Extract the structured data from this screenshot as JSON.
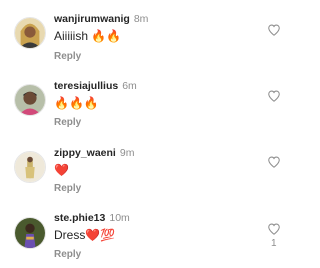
{
  "comments": [
    {
      "username": "wanjirumwanig",
      "time": "8m",
      "text": "Aiiiiish 🔥🔥",
      "reply": "Reply",
      "avatar_icon": "user-avatar-icon",
      "like_icon": "heart-outline-icon",
      "avatar_bg": "#caa24f"
    },
    {
      "username": "teresiajullius",
      "time": "6m",
      "text": "🔥🔥🔥",
      "reply": "Reply",
      "avatar_icon": "user-avatar-icon",
      "like_icon": "heart-outline-icon",
      "avatar_bg": "#9aa38c"
    },
    {
      "username": "zippy_waeni",
      "time": "9m",
      "text": "❤️",
      "reply": "Reply",
      "avatar_icon": "user-avatar-icon",
      "like_icon": "heart-outline-icon",
      "avatar_bg": "#d9d3c4"
    },
    {
      "username": "ste.phie13",
      "time": "10m",
      "text": "Dress❤️💯",
      "reply": "Reply",
      "avatar_icon": "user-avatar-icon",
      "like_icon": "heart-outline-icon",
      "like_count": "1",
      "avatar_bg": "#5b6a3a"
    }
  ]
}
